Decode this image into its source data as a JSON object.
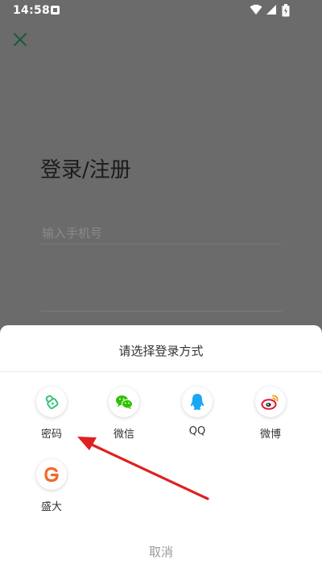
{
  "status_bar": {
    "time": "14:58"
  },
  "page": {
    "title": "登录/注册",
    "phone_placeholder": "输入手机号"
  },
  "sheet": {
    "title": "请选择登录方式",
    "options": [
      {
        "label": "密码",
        "icon": "lock-icon"
      },
      {
        "label": "微信",
        "icon": "wechat-icon"
      },
      {
        "label": "QQ",
        "icon": "qq-icon"
      },
      {
        "label": "微博",
        "icon": "weibo-icon"
      },
      {
        "label": "盛大",
        "icon": "shanda-icon"
      }
    ],
    "cancel_label": "取消"
  },
  "colors": {
    "lock": "#33c27a",
    "wechat": "#2dc100",
    "qq": "#1aa6f5",
    "weibo": "#e6162d",
    "shanda": "#f06a2a",
    "annotation_arrow": "#e02020"
  }
}
